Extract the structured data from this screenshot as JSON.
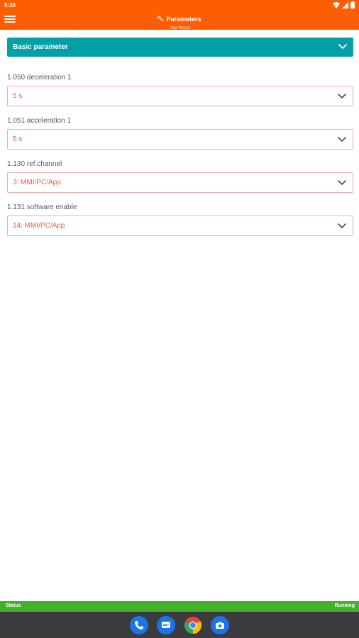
{
  "status_bar": {
    "time": "5:36"
  },
  "app_bar": {
    "title": "Parameters",
    "subtitle": "• INV-TPH-02"
  },
  "section": {
    "title": "Basic parameter"
  },
  "parameters": [
    {
      "label": "1.050 deceleration 1",
      "value": "5 s"
    },
    {
      "label": "1.051 acceleration 1",
      "value": "5 s"
    },
    {
      "label": "1.130 ref.channel",
      "value": "3: MMI/PC/App"
    },
    {
      "label": "1.131 software enable",
      "value": "14: MMI/PC/App"
    }
  ],
  "footer": {
    "status_label": "Status",
    "status_value": "Running"
  },
  "dock": {
    "apps": [
      "phone-icon",
      "messages-icon",
      "chrome-icon",
      "camera-icon"
    ]
  },
  "colors": {
    "app_bar": "#ff5e00",
    "section_header": "#00a0a6",
    "field_border": "#f4aaaa",
    "field_value": "#f05a45",
    "footer": "#44b02c",
    "nav_bar": "#3c3c3f"
  }
}
